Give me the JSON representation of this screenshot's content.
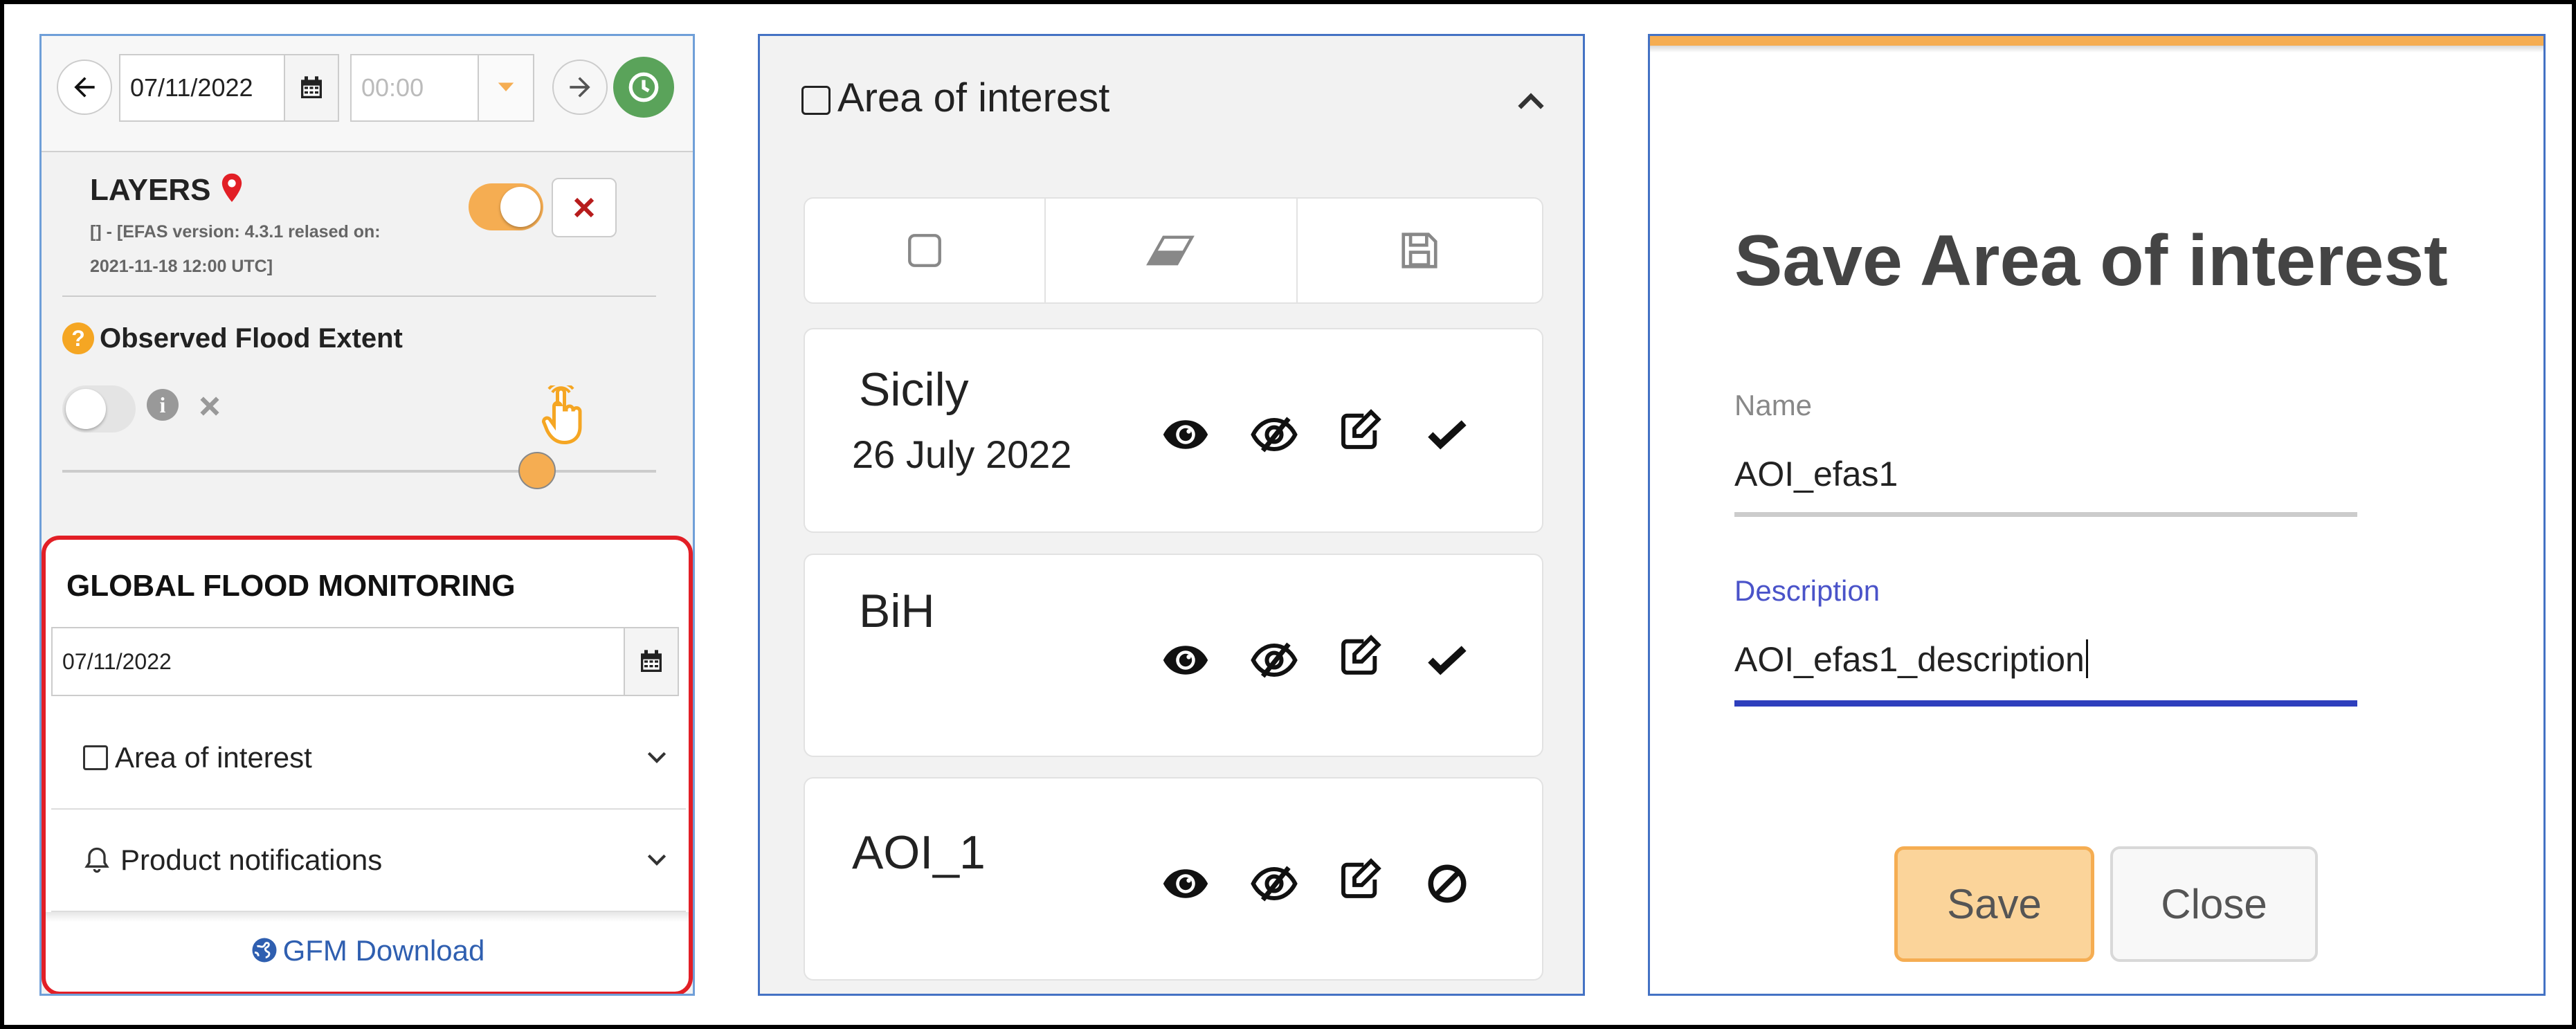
{
  "layers_panel": {
    "toolbar": {
      "date": "07/11/2022",
      "time_placeholder": "00:00"
    },
    "layers": {
      "title": "LAYERS",
      "version_line1": "[] - [EFAS version: 4.3.1 relased on:",
      "version_line2": "2021-11-18 12:00 UTC]",
      "observed_flood_extent": "Observed Flood Extent",
      "toggle_on": true,
      "opacity": 0.8
    },
    "gfm": {
      "title": "GLOBAL FLOOD MONITORING",
      "date": "07/11/2022",
      "area_of_interest": "Area of interest",
      "product_notifications": "Product notifications",
      "download_link": "GFM Download"
    }
  },
  "aoi_panel": {
    "header": "Area of interest",
    "items": [
      {
        "name": "Sicily",
        "date": "26 July 2022",
        "status_icon": "check-icon"
      },
      {
        "name": "BiH",
        "date": "",
        "status_icon": "check-icon"
      },
      {
        "name": "AOI_1",
        "date": "",
        "status_icon": "ban-icon"
      }
    ]
  },
  "save_dialog": {
    "title": "Save Area of interest",
    "name_label": "Name",
    "name_value": "AOI_efas1",
    "description_label": "Description",
    "description_value": "AOI_efas1_description",
    "save_button": "Save",
    "close_button": "Close"
  },
  "colors": {
    "accent_orange": "#f5ad52",
    "accent_blue": "#2e3fbd",
    "red_border": "#e21f26",
    "green_clock": "#5aa35a",
    "link_blue": "#2f5fb0"
  }
}
